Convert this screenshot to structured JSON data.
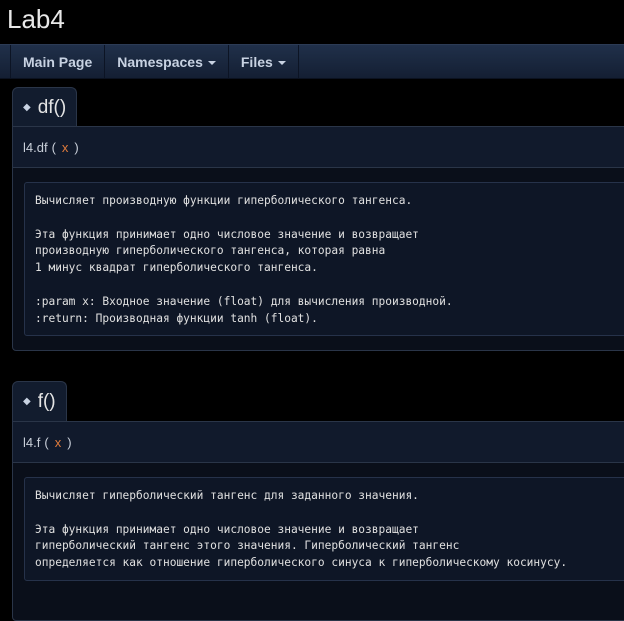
{
  "header": {
    "project_name": "Lab4"
  },
  "nav": {
    "items": [
      {
        "label": "Main Page",
        "dropdown": false
      },
      {
        "label": "Namespaces",
        "dropdown": true
      },
      {
        "label": "Files",
        "dropdown": true
      }
    ]
  },
  "members": [
    {
      "icon": "diamond-icon",
      "title": "df()",
      "prototype": {
        "name": "l4.df",
        "open": "(",
        "param": "x",
        "close": ")"
      },
      "doc": "Вычисляет производную функции гиперболического тангенса.\n\nЭта функция принимает одно числовое значение и возвращает\nпроизводную гиперболического тангенса, которая равна\n1 минус квадрат гиперболического тангенса.\n\n:param x: Входное значение (float) для вычисления производной.\n:return: Производная функции tanh (float)."
    },
    {
      "icon": "diamond-icon",
      "title": "f()",
      "prototype": {
        "name": "l4.f",
        "open": "(",
        "param": "x",
        "close": ")"
      },
      "doc": "Вычисляет гиперболический тангенс для заданного значения.\n\nЭта функция принимает одно числовое значение и возвращает\nгиперболический тангенс этого значения. Гиперболический тангенс\nопределяется как отношение гиперболического синуса к гиперболическому косинусу."
    }
  ],
  "colors": {
    "background": "#000000",
    "navbar": "#1a2740",
    "param": "#e07b3c",
    "doc_background": "#0e1626"
  }
}
